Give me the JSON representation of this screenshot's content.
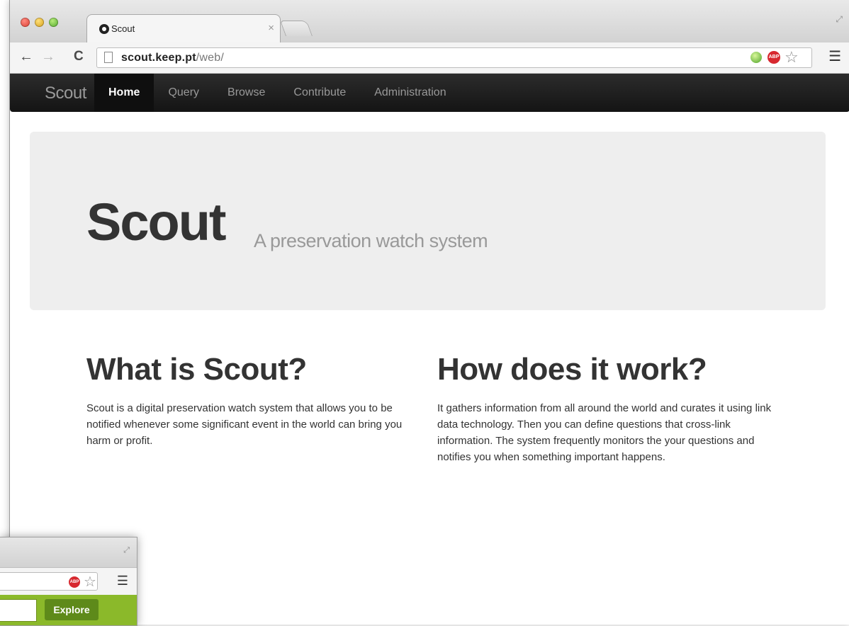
{
  "browser": {
    "tab_title": "Scout",
    "tab_close": "×",
    "url_host": "scout.keep.pt",
    "url_path": "/web/",
    "abp_label": "ABP"
  },
  "navbar": {
    "brand": "Scout",
    "links": [
      {
        "label": "Home",
        "active": true
      },
      {
        "label": "Query"
      },
      {
        "label": "Browse"
      },
      {
        "label": "Contribute"
      },
      {
        "label": "Administration"
      }
    ]
  },
  "hero": {
    "title": "Scout",
    "subtitle": "A preservation watch system"
  },
  "sections": [
    {
      "heading": "What is Scout?",
      "body": "Scout is a digital preservation watch system that allows you to be notified whenever some significant event in the world can bring you harm or profit."
    },
    {
      "heading": "How does it work?",
      "body": "It gathers information from all around the world and curates it using link data technology. Then you can define questions that cross-link information. The system frequently monitors the your questions and notifies you when something important happens."
    }
  ],
  "second_window": {
    "abp_label": "ABP",
    "explore_label": "Explore"
  },
  "colors": {
    "navbar_bg": "#1b1b1b",
    "hero_bg": "#eeeeee",
    "explore_bar": "#8bb92a",
    "explore_button": "#5e8a1a"
  }
}
